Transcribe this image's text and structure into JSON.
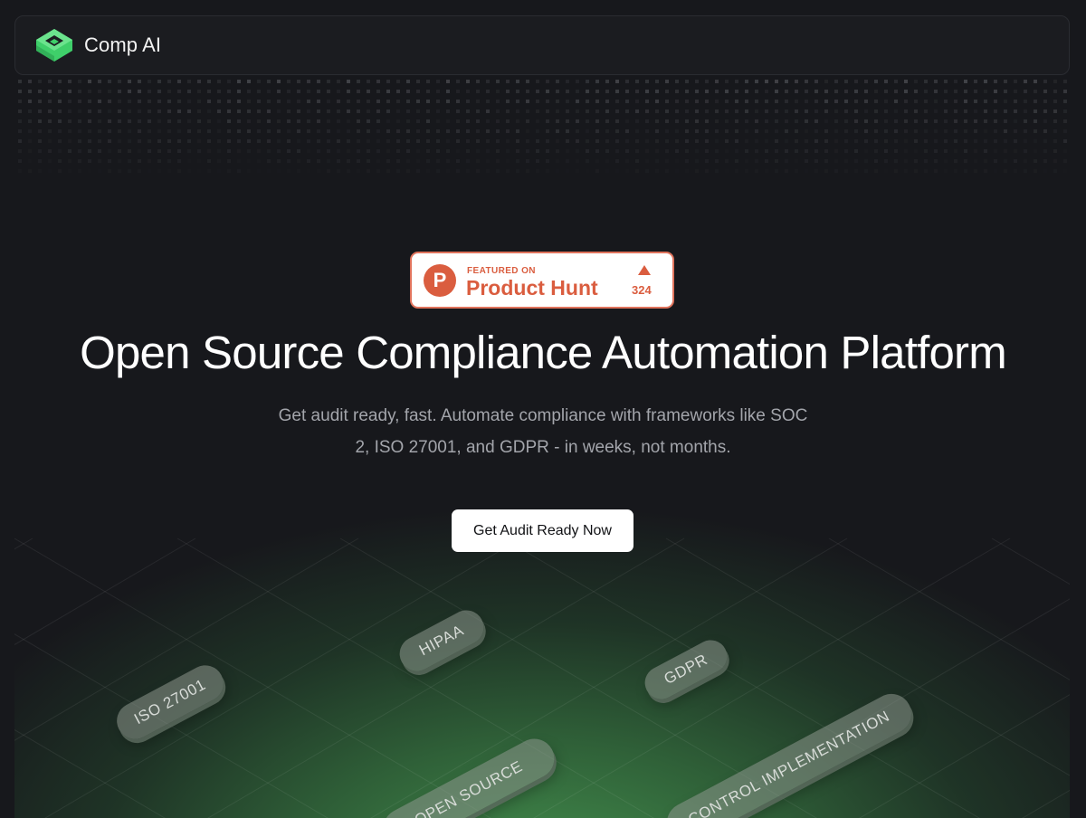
{
  "navbar": {
    "brand": "Comp AI",
    "logo_color": "#3fcf6a"
  },
  "product_hunt": {
    "featured_label": "FEATURED ON",
    "name": "Product Hunt",
    "logo_letter": "P",
    "upvotes": "324",
    "accent_color": "#da5d3f"
  },
  "hero": {
    "title": "Open Source Compliance Automation Platform",
    "subtitle": "Get audit ready, fast. Automate compliance with frameworks like SOC 2, ISO 27001, and GDPR - in weeks, not months.",
    "cta_label": "Get Audit Ready Now"
  },
  "tags": [
    "HIPAA",
    "GDPR",
    "ISO 27001",
    "OPEN SOURCE",
    "CONTROL IMPLEMENTATION"
  ],
  "colors": {
    "background": "#17181c",
    "glow": "#46964f"
  }
}
